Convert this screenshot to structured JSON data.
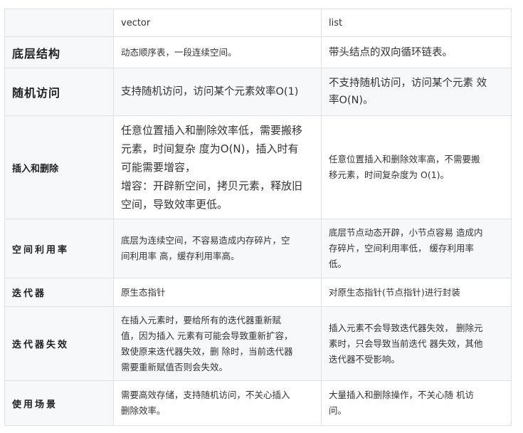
{
  "table": {
    "headers": [
      "",
      "vector",
      "list"
    ],
    "rows": [
      {
        "label": "底层结构",
        "vector": [
          "动态顺序表，一段连续空间。"
        ],
        "list": [
          "带头结点的双向循环链表。"
        ]
      },
      {
        "label": "随机访问",
        "vector": [
          "支持随机访问，访问某个元素效率O(1)"
        ],
        "list": [
          "不支持随机访问，访问某个元素 效",
          "率O(N)。"
        ]
      },
      {
        "label": "插入和删除",
        "vector": [
          "任意位置插入和删除效率低，需要搬移",
          "元素，时间复杂 度为O(N)，插入时有",
          "可能需要增容，",
          "增容：开辟新空间，拷贝元素，释放旧",
          "空间，导致效率更低。"
        ],
        "list": [
          "任意位置插入和删除效率高，不需要搬",
          "移元素，时间复杂度为 O(1)。"
        ]
      },
      {
        "label": "空间利用率",
        "vector": [
          "底层为连续空间，不容易造成内存碎片，空",
          "间利用率 高，缓存利用率高。"
        ],
        "list": [
          "底层节点动态开辟，小节点容易 造成内",
          "存碎片，空间利用率低， 缓存利用率",
          "低。"
        ]
      },
      {
        "label": "迭代器",
        "vector": [
          "原生态指针"
        ],
        "list": [
          " 对原生态指针(节点指针)进行封装"
        ]
      },
      {
        "label": "迭代器失效",
        "vector": [
          "在插入元素时，要给所有的迭代器重新赋",
          "值，因为插入 元素有可能会导致重新扩容，",
          "致使原来迭代器失效，删 除时，当前迭代器",
          "需要重新赋值否则会失效。"
        ],
        "list": [
          "插入元素不会导致迭代器失效， 删除元",
          "素时，只会导致当前迭代 器失效，其他",
          "迭代器不受影响。"
        ]
      },
      {
        "label": "使用场景",
        "vector": [
          "需要高效存储，支持随机访问，不关心插入",
          "删除效率。"
        ],
        "list": [
          "大量插入和删除操作，不关心随 机访",
          "问。"
        ]
      }
    ]
  }
}
